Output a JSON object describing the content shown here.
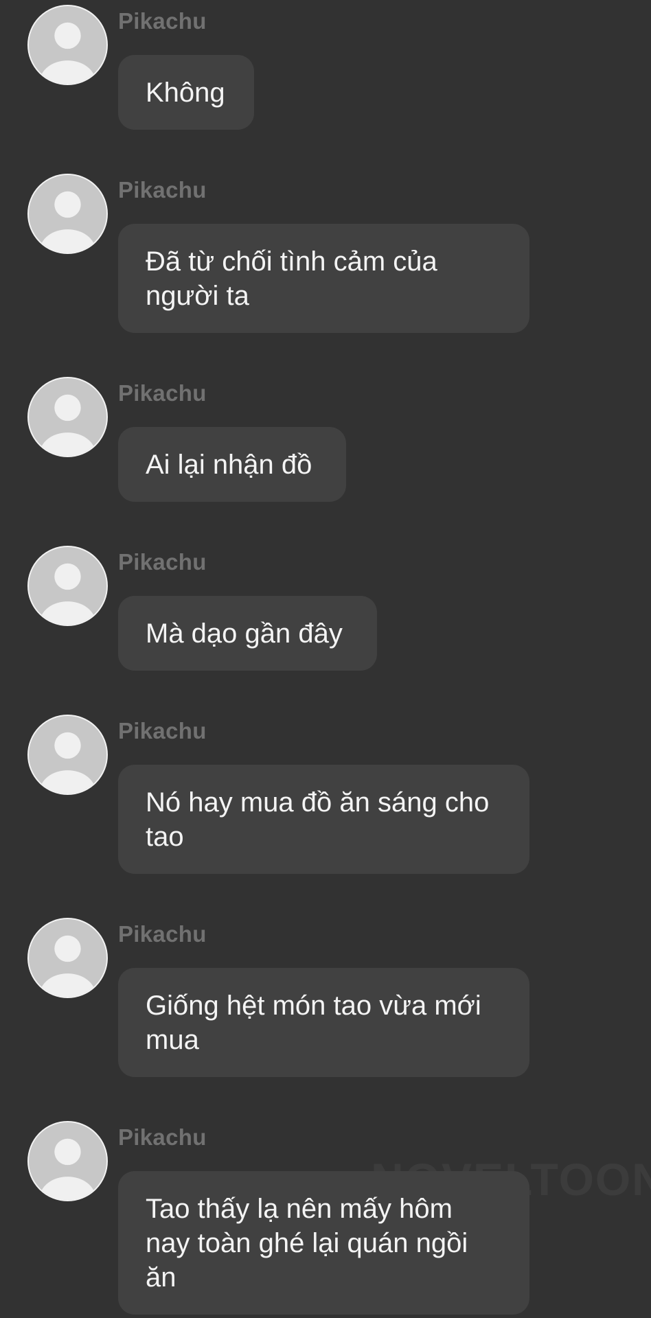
{
  "messages": [
    {
      "sender": "Pikachu",
      "avatar": "default-user-icon",
      "text": "Không"
    },
    {
      "sender": "Pikachu",
      "avatar": "default-user-icon",
      "text": "Đã từ chối tình cảm của người ta"
    },
    {
      "sender": "Pikachu",
      "avatar": "default-user-icon",
      "text": "Ai lại nhận đồ"
    },
    {
      "sender": "Pikachu",
      "avatar": "default-user-icon",
      "text": "Mà dạo gần đây"
    },
    {
      "sender": "Pikachu",
      "avatar": "default-user-icon",
      "text": "Nó hay mua đồ ăn sáng cho tao"
    },
    {
      "sender": "Pikachu",
      "avatar": "default-user-icon",
      "text": "Giống hệt món tao vừa mới mua"
    },
    {
      "sender": "Pikachu",
      "avatar": "default-user-icon",
      "text": "Tao thấy lạ nên mấy hôm nay toàn ghé lại quán ngồi ăn"
    }
  ],
  "watermark": "NOVELTOON",
  "colors": {
    "background": "#323232",
    "bubble": "#414141",
    "sender": "#717171",
    "text": "#f4f4f4"
  }
}
